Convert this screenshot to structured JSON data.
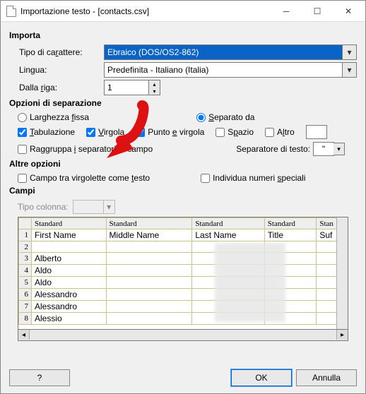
{
  "window": {
    "title": "Importazione testo - [contacts.csv]"
  },
  "import": {
    "heading": "Importa",
    "charset_label_pre": "Tipo di ca",
    "charset_label_u": "r",
    "charset_label_post": "attere:",
    "charset_value": "Ebraico (DOS/OS2-862)",
    "lang_label_pre": "Lin",
    "lang_label_u": "g",
    "lang_label_post": "ua:",
    "lang_value": "Predefinita - Italiano (Italia)",
    "row_label_pre": "Dalla ",
    "row_label_u": "r",
    "row_label_post": "iga:",
    "row_value": "1"
  },
  "sep": {
    "heading": "Opzioni di separazione",
    "fixed_pre": "Larghezza ",
    "fixed_u": "f",
    "fixed_post": "issa",
    "by_pre": "",
    "by_u": "S",
    "by_post": "eparato da",
    "tab_u": "T",
    "tab_post": "abulazione",
    "comma_u": "V",
    "comma_post": "irgola",
    "semi_pre": "Punto ",
    "semi_u": "e",
    "semi_post": " virgola",
    "space_pre": "S",
    "space_u": "p",
    "space_post": "azio",
    "other_pre": "A",
    "other_u": "l",
    "other_post": "tro",
    "merge_pre": "Raggruppa ",
    "merge_u": "i",
    "merge_post": " separatori di campo",
    "textsep_pre": "Separatore di tes",
    "textsep_u": "t",
    "textsep_post": "o:",
    "textsep_value": "\""
  },
  "other": {
    "heading": "Altre opzioni",
    "quoted_pre": "Campo tra virgolette come ",
    "quoted_u": "t",
    "quoted_post": "esto",
    "detect_pre": "Individua numeri ",
    "detect_u": "s",
    "detect_post": "peciali"
  },
  "fields": {
    "heading": "Campi",
    "coltype_label": "Tipo colonna:",
    "headers": [
      "Standard",
      "Standard",
      "Standard",
      "Standard",
      "Stan"
    ],
    "row1": [
      "First Name",
      "Middle Name",
      "Last Name",
      "Title",
      "Suf"
    ],
    "names": [
      "",
      "Alberto",
      "Aldo",
      "Aldo",
      "Alessandro",
      "Alessandro",
      "Alessio"
    ]
  },
  "footer": {
    "help": "?",
    "ok": "OK",
    "cancel": "Annulla"
  }
}
